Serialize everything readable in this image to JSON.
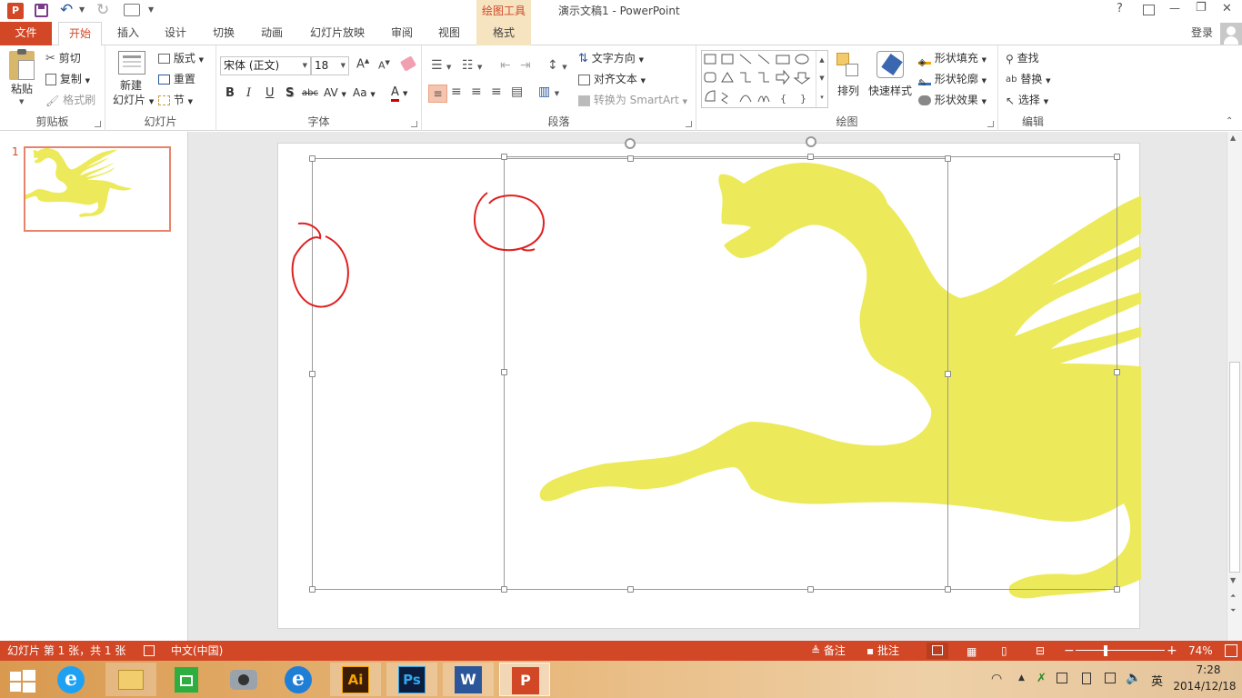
{
  "titlebar": {
    "title": "演示文稿1 - PowerPoint",
    "context_tab_group": "绘图工具",
    "help": "?",
    "minimize": "—",
    "restore": "❐",
    "close": "✕"
  },
  "tabs": {
    "file": "文件",
    "items": [
      "开始",
      "插入",
      "设计",
      "切换",
      "动画",
      "幻灯片放映",
      "审阅",
      "视图"
    ],
    "format": "格式",
    "login": "登录"
  },
  "ribbon": {
    "clipboard": {
      "label": "剪贴板",
      "paste": "粘贴",
      "cut": "剪切",
      "copy": "复制",
      "format_painter": "格式刷"
    },
    "slides": {
      "label": "幻灯片",
      "new_slide_line1": "新建",
      "new_slide_line2": "幻灯片",
      "layout": "版式",
      "reset": "重置",
      "section": "节"
    },
    "font": {
      "label": "字体",
      "font_name": "宋体 (正文)",
      "font_size": "18",
      "bold": "B",
      "italic": "I",
      "underline": "U",
      "shadow": "S",
      "strike": "abc",
      "spacing": "AV",
      "case": "Aa",
      "color": "A"
    },
    "paragraph": {
      "label": "段落",
      "text_direction": "文字方向",
      "align_text": "对齐文本",
      "smartart": "转换为 SmartArt"
    },
    "drawing": {
      "label": "绘图",
      "arrange": "排列",
      "quick_styles": "快速样式",
      "fill": "形状填充",
      "outline": "形状轮廓",
      "effects": "形状效果"
    },
    "editing": {
      "label": "编辑",
      "find": "查找",
      "replace": "替换",
      "select": "选择"
    }
  },
  "thumbnails": [
    {
      "number": "1"
    }
  ],
  "statusbar": {
    "slide_info": "幻灯片 第 1 张，共 1 张",
    "language": "中文(中国)",
    "notes": "备注",
    "comments": "批注",
    "zoom": "74%",
    "zoom_out": "−",
    "zoom_in": "+"
  },
  "taskbar": {
    "time": "7:28",
    "date": "2014/12/18",
    "ime": "英",
    "apps": [
      "ie-icon",
      "file-explorer-icon",
      "store-icon",
      "camera-icon",
      "ie2-icon",
      "illustrator-icon",
      "photoshop-icon",
      "word-icon",
      "powerpoint-icon"
    ],
    "ai_label": "Ai",
    "ps_label": "Ps",
    "word_label": "W",
    "ppt_label": "P"
  },
  "colors": {
    "accent": "#d24726",
    "context_tab": "#f6e3c0",
    "pegasus": "#ecea5a",
    "ink": "#e02020"
  }
}
